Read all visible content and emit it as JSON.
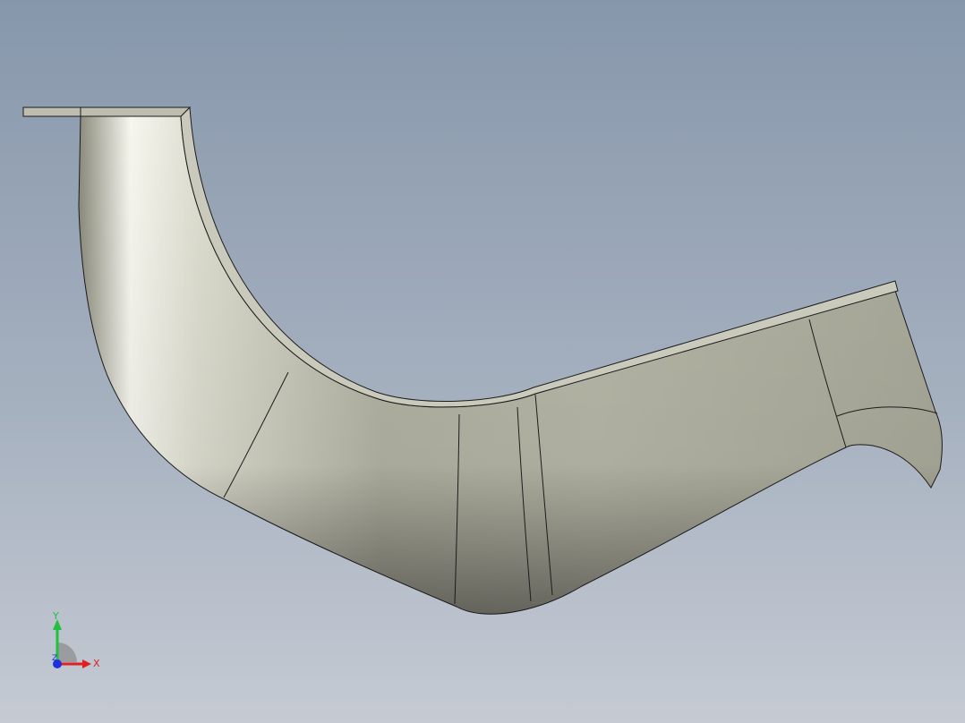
{
  "viewport": {
    "background_top": "#8797ab",
    "background_bottom": "#c5cad3"
  },
  "model": {
    "body_color": "#b5b5a7",
    "highlight_color": "#f6f6ee",
    "shadow_color": "#3a3a30",
    "edge_color": "#1c1c1c",
    "top_face_color": "#c9c9bc"
  },
  "triad": {
    "x_label": "X",
    "y_label": "Y",
    "z_label": "Z",
    "x_color": "#e02020",
    "y_color": "#20c040",
    "z_color": "#2030e0"
  }
}
